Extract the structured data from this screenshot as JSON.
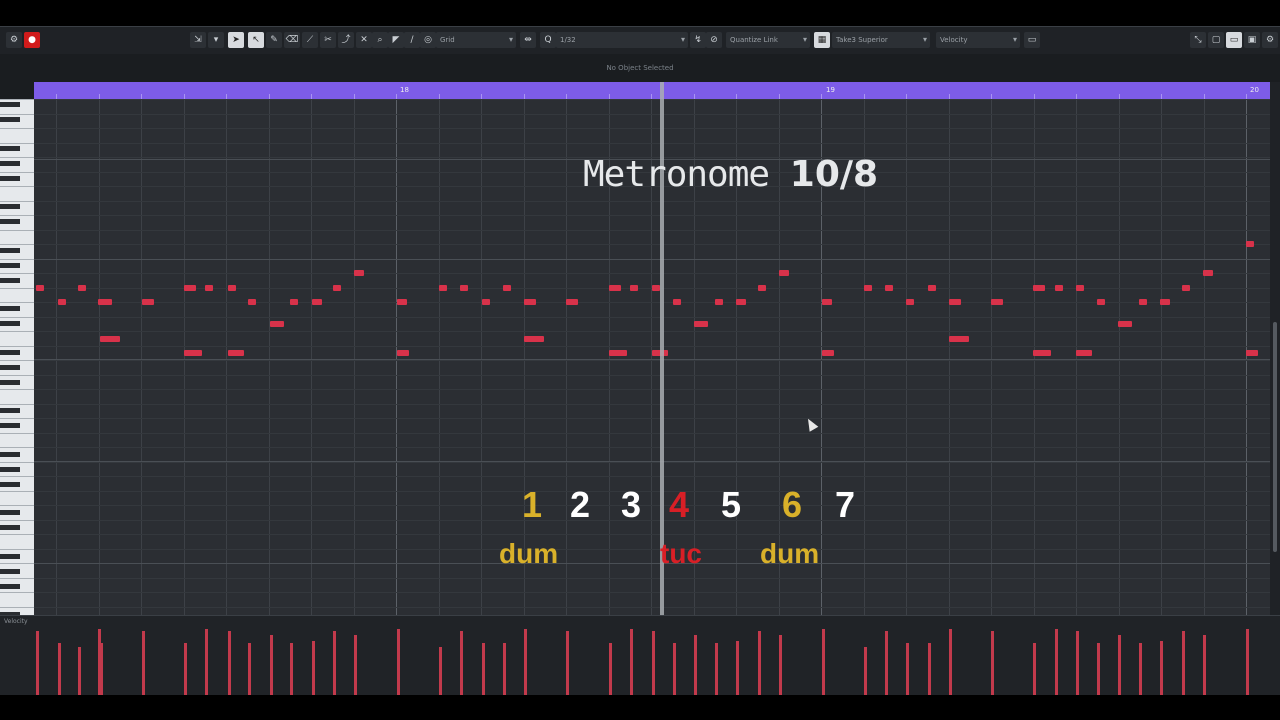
{
  "toolbar": {
    "grid_type": "Grid",
    "quantize_value": "1/32",
    "quantize_link": "Quantize Link",
    "scale_track": "Take3 Superior",
    "controller_lane": "Velocity"
  },
  "info_line": "No Object Selected",
  "ruler": {
    "bar_labels": [
      "18",
      "19",
      "20"
    ]
  },
  "velocity_lane": {
    "label": "Velocity"
  },
  "overlay": {
    "title_word": "Metronome",
    "title_signature": "10/8",
    "beats": [
      "1",
      "2",
      "3",
      "4",
      "5",
      "6",
      "7"
    ],
    "syllables": [
      "dum",
      "tuc",
      "dum"
    ]
  },
  "colors": {
    "ruler": "#7d5ce8",
    "note": "#d8324a",
    "accent_dum": "#d9b12a",
    "accent_tuc": "#d81f26",
    "beat_white": "#ffffff",
    "background": "#2b2e33"
  }
}
